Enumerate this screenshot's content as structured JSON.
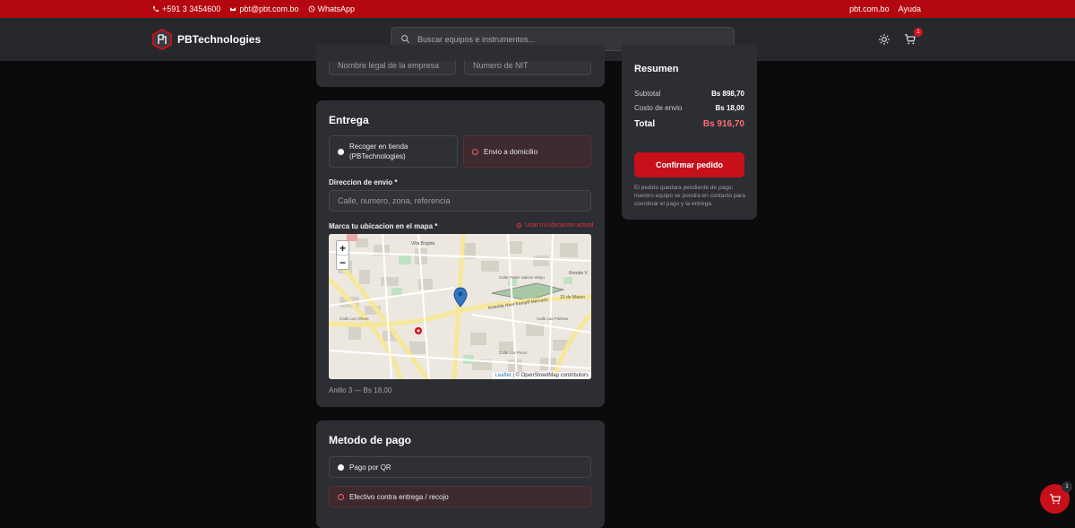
{
  "topbar": {
    "phone": "+591 3 3454600",
    "email": "pbt@pbt.com.bo",
    "whatsapp": "WhatsApp",
    "site": "pbt.com.bo",
    "help": "Ayuda"
  },
  "header": {
    "brand": "PBTechnologies",
    "search_placeholder": "Buscar equipos e instrumentos...",
    "cart_count": "1"
  },
  "billing": {
    "legal_name_placeholder": "Nombre legal de la empresa",
    "nit_placeholder": "Numero de NIT"
  },
  "delivery": {
    "title": "Entrega",
    "option_pickup": "Recoger en tienda (PBTechnologies)",
    "option_home": "Envio a domicilio",
    "address_label": "Direccion de envio *",
    "address_placeholder": "Calle, numero, zona, referencia",
    "map_label": "Marca tu ubicacion en el mapa *",
    "use_location": "Usar mi ubicacion actual",
    "zoom_in": "+",
    "zoom_out": "−",
    "attribution_leaflet": "Leaflet",
    "attribution_osm": "| © OpenStreetMap contributors",
    "zone_note": "Anillo 3 — Bs 18,00",
    "map_streets": [
      "Villa Brigida",
      "Avenida Noel Kempff Mercado",
      "Román V.",
      "23 de Marzo",
      "Calle Padre Salces Wayu",
      "Calle Los Olivos",
      "Calle Las Palmas",
      "Calle Los Pinos"
    ]
  },
  "payment": {
    "title": "Metodo de pago",
    "option_qr": "Pago por QR",
    "option_cash": "Efectivo contra entrega / recojo"
  },
  "summary": {
    "title": "Resumen",
    "subtotal_label": "Subtotal",
    "subtotal_value": "Bs 898,70",
    "shipping_label": "Costo de envio",
    "shipping_value": "Bs 18,00",
    "total_label": "Total",
    "total_value": "Bs 916,70",
    "confirm_label": "Confirmar pedido",
    "note": "El pedido quedara pendiente de pago; nuestro equipo se pondra en contacto para coordinar el pago y la entrega."
  },
  "fab": {
    "cart_count": "1"
  },
  "colors": {
    "brand_red": "#c8101b",
    "total_red": "#ff6b73",
    "card": "#2d2e33",
    "bg": "#0b0b0c"
  }
}
